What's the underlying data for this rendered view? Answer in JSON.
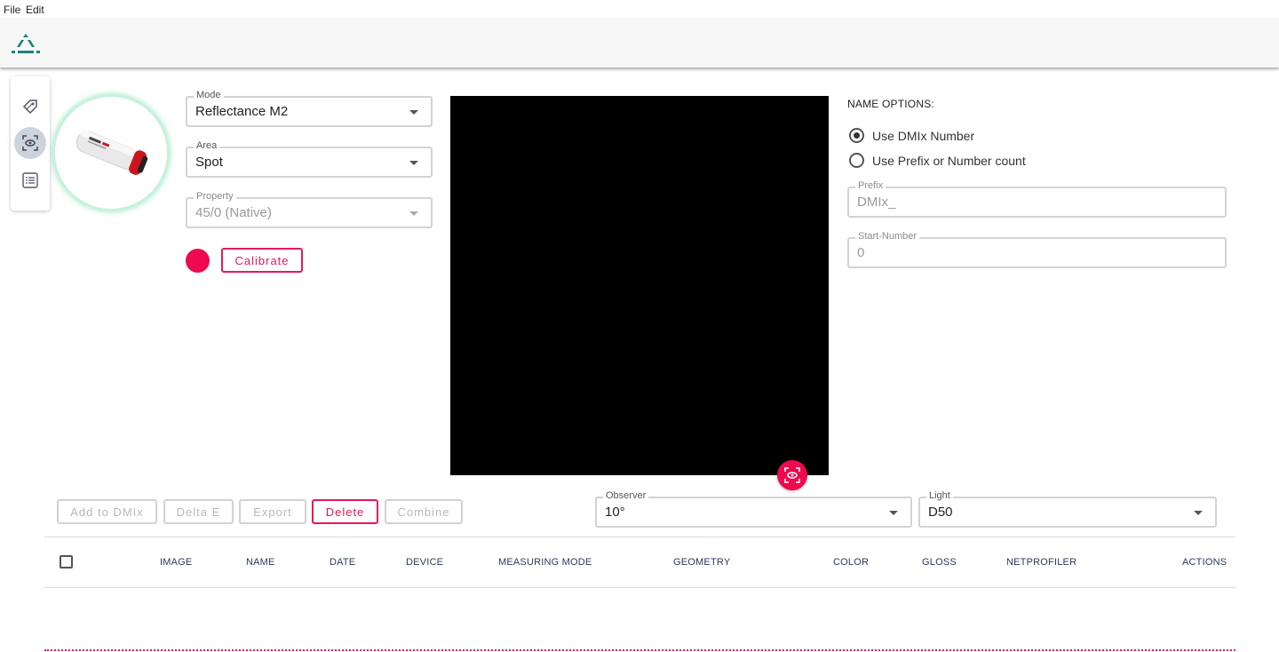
{
  "menu": {
    "file": "File",
    "edit": "Edit"
  },
  "colors": {
    "accent": "#ed0a4e",
    "teal": "#15847a"
  },
  "sidebar": {
    "items": [
      {
        "icon": "swatch-tag-icon"
      },
      {
        "icon": "measure-eye-icon",
        "active": true
      },
      {
        "icon": "list-icon"
      }
    ]
  },
  "device": {
    "image_alt": "ColorReader PRO device"
  },
  "settings": {
    "mode": {
      "label": "Mode",
      "value": "Reflectance M2"
    },
    "area": {
      "label": "Area",
      "value": "Spot"
    },
    "property": {
      "label": "Property",
      "value": "45/0 (Native)"
    },
    "calibrate_label": "Calibrate"
  },
  "name_options": {
    "title": "NAME OPTIONS:",
    "radio_dmix": "Use DMIx Number",
    "radio_prefix": "Use Prefix or Number count",
    "prefix": {
      "label": "Prefix",
      "value": "DMIx_"
    },
    "start_number": {
      "label": "Start-Number",
      "value": "0"
    }
  },
  "toolbar": {
    "add": "Add to DMIx",
    "delta": "Delta E",
    "export": "Export",
    "delete": "Delete",
    "combine": "Combine"
  },
  "observer": {
    "label": "Observer",
    "value": "10°"
  },
  "light": {
    "label": "Light",
    "value": "D50"
  },
  "table": {
    "columns": [
      "IMAGE",
      "NAME",
      "DATE",
      "DEVICE",
      "MEASURING MODE",
      "GEOMETRY",
      "COLOR",
      "GLOSS",
      "NETPROFILER",
      "ACTIONS"
    ]
  }
}
